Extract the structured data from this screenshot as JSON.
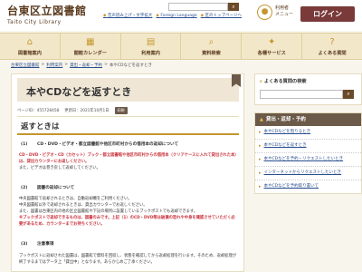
{
  "header": {
    "logo_jp": "台東区立図書館",
    "logo_en": "Taito City Library",
    "links": [
      "音声読み上げ・文字拡大",
      "Foreign Language",
      "区のトップページへ"
    ],
    "user_label_line1": "利用者",
    "user_label_line2": "メニュー",
    "login": "ログイン"
  },
  "nav": [
    {
      "label": "図書館案内",
      "icon": "building-icon"
    },
    {
      "label": "開館カレンダー",
      "icon": "calendar-icon"
    },
    {
      "label": "利用案内",
      "icon": "guide-icon"
    },
    {
      "label": "資料検索",
      "icon": "search-icon"
    },
    {
      "label": "各種サービス",
      "icon": "service-icon"
    },
    {
      "label": "よくある質問",
      "icon": "question-icon"
    }
  ],
  "breadcrumb": [
    "台東区立図書館",
    "利用案内",
    "貸出・返却・予約",
    "本やCDなどを返すとき"
  ],
  "main": {
    "title": "本やCDなどを返すとき",
    "page_id": "ページID：455728458",
    "updated": "更新日：2021年10月1日",
    "print": "印刷",
    "section_title": "返すときは",
    "sub1": "CD・DVD・ビデオ・都立図書館や他区市町村からの借用本の返却について",
    "para1_red": "CD・DVD・ビデオ・CD（カセット）ブック・都立図書館や他区市町村からの借用本（クリアケースに入れて貸出された本）は、貸出カウンターにお返しください。",
    "para1": "また、ビデオは巻き戻して返却してください。",
    "sub2": "図書の返却について",
    "para2a": "中央図書館で返却されるときは、自動返却機をご利用ください。",
    "para2b": "中央図書館以外で返却されるときは、貸出カウンターでお返しください。",
    "para2c": "また、図書は台東区内の他の区立図書館や下記の場所に設置しているブックポストでも返却できます。",
    "para2_red": "※ブックポストで返却できるものは、図書のみです。上記（1）のCD・DVD等は破損の恐れや中身を確認させていただく必要があるため、カウンターまでお持ちください。",
    "sub3": "注意事項",
    "para3": "ブックポストに返却された図書は、図書館で資料を回収し、状態を確認してから返却処理を行います。そのため、返却処理が終了するまではデータ上「貸出中」となります。あらかじめご了承ください。"
  },
  "sidebar": {
    "faq_title": "よくある質問の検索",
    "menu_title": "貸出・返却・予約",
    "items": [
      "本やCDなどを借りるとき",
      "本やCDなどを返すとき",
      "本やCDなどを予約・リクエストしたいとき",
      "インターネットからリクエストしたいとき",
      "本やCDなどを予約取り置いて"
    ]
  },
  "colors": {
    "brand_brown": "#5a3a1e",
    "accent_gold": "#c5962e",
    "login_bg": "#7a3a3a",
    "link_blue": "#2a4f8f",
    "alert_red": "#c8323c"
  }
}
